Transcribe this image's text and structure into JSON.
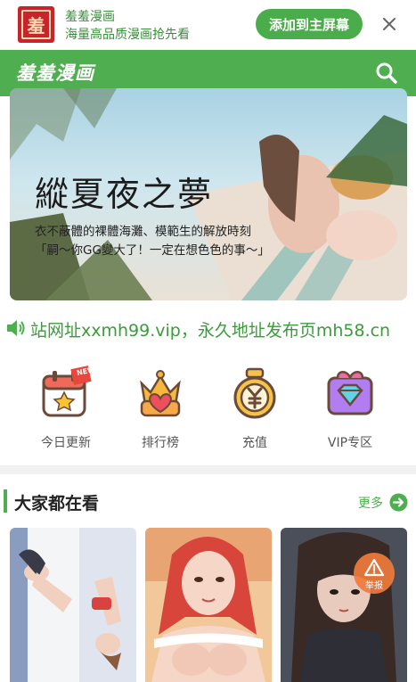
{
  "install_bar": {
    "app_name": "羞羞漫画",
    "app_desc": "海量高品质漫画抢先看",
    "logo_char": "羞",
    "add_button": "添加到主屏幕",
    "close_icon": "close-icon"
  },
  "header": {
    "brand": "羞羞漫画",
    "search_icon": "search-icon"
  },
  "hero": {
    "title": "縱夏夜之夢",
    "subtitle_line1": "衣不蔽體的裸體海灘、模範生的解放時刻",
    "subtitle_line2": "「嗣～你GG變大了！一定在想色色的事～」"
  },
  "notice": {
    "icon": "speaker-icon",
    "text": "\u0005站网址xxmh99.vip，永久地址发布页mh58.cn"
  },
  "quick_nav": [
    {
      "label": "今日更新",
      "icon": "calendar-star-icon",
      "badge": "NEW"
    },
    {
      "label": "排行榜",
      "icon": "crown-heart-icon"
    },
    {
      "label": "充值",
      "icon": "yen-coin-icon"
    },
    {
      "label": "VIP专区",
      "icon": "vip-diamond-gift-icon"
    }
  ],
  "section": {
    "title": "大家都在看",
    "more": "更多",
    "more_icon": "arrow-right-circle-icon"
  },
  "cards": [
    {
      "name": "manga-cover-1"
    },
    {
      "name": "manga-cover-2"
    },
    {
      "name": "manga-cover-3",
      "report": "举报",
      "report_icon": "warning-icon"
    }
  ],
  "colors": {
    "brand_green": "#4fae4f",
    "button_green": "#4bac4b",
    "logo_red": "#c8242b",
    "report_orange": "#ef7b3c"
  }
}
